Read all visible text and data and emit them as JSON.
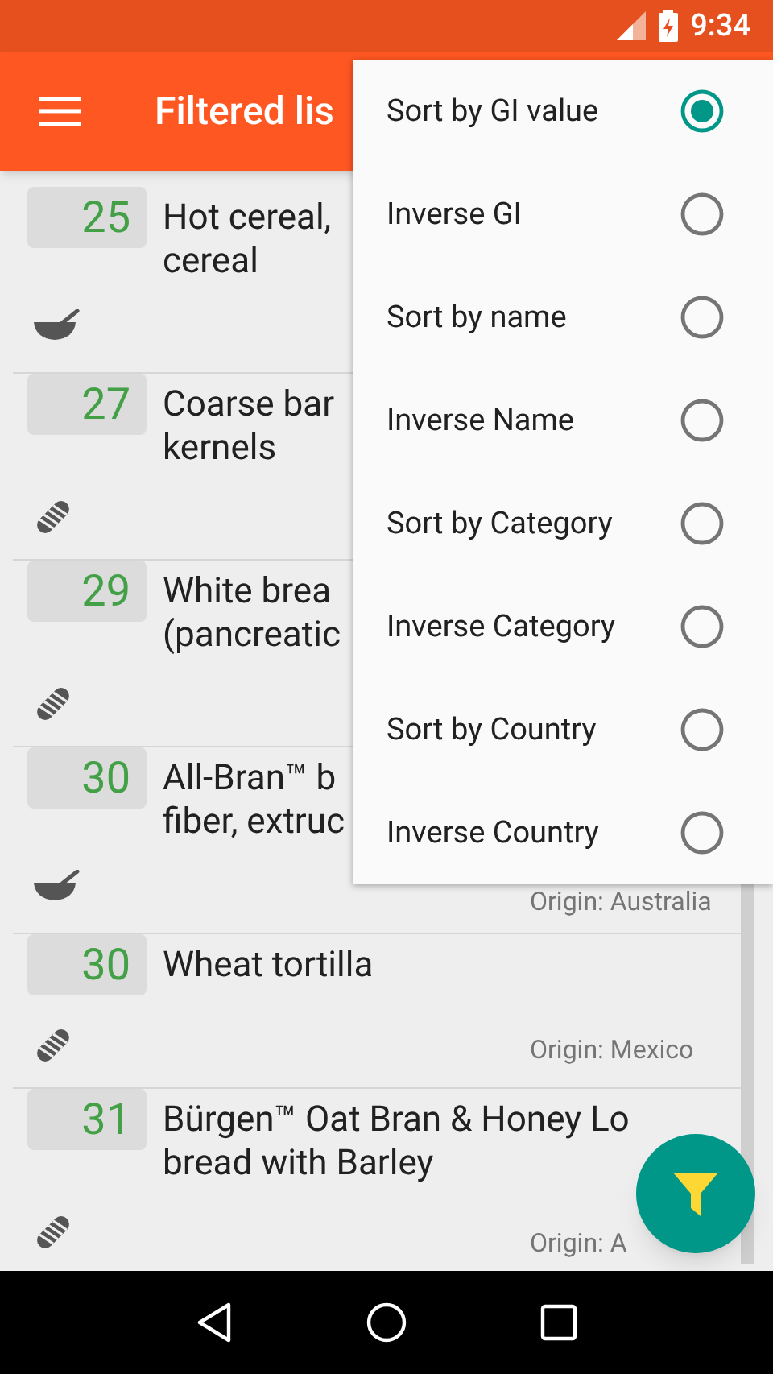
{
  "status_bar": {
    "time": "9:34"
  },
  "app_bar": {
    "title": "Filtered lis"
  },
  "rows": [
    {
      "gi": "25",
      "title_lines": [
        "Hot cereal,",
        "cereal"
      ],
      "kind": "bowl"
    },
    {
      "gi": "27",
      "title_lines": [
        "Coarse bar",
        "kernels"
      ],
      "kind": "bread"
    },
    {
      "gi": "29",
      "title_lines": [
        "White brea",
        "(pancreatic"
      ],
      "kind": "bread"
    },
    {
      "gi": "30",
      "title_lines": [
        "All-Bran™ b",
        "fiber, extruc"
      ],
      "kind": "bowl",
      "origin": "Origin: Australia"
    },
    {
      "gi": "30",
      "title_lines": [
        "Wheat tortilla"
      ],
      "kind": "bread",
      "origin": "Origin: Mexico"
    },
    {
      "gi": "31",
      "title_lines": [
        "Bürgen™ Oat Bran & Honey Lo",
        "bread with Barley"
      ],
      "kind": "bread",
      "origin": "Origin: A"
    }
  ],
  "sort_menu": [
    {
      "label": "Sort by GI value",
      "selected": true
    },
    {
      "label": "Inverse GI",
      "selected": false
    },
    {
      "label": "Sort by name",
      "selected": false
    },
    {
      "label": "Inverse Name",
      "selected": false
    },
    {
      "label": "Sort by Category",
      "selected": false
    },
    {
      "label": "Inverse Category",
      "selected": false
    },
    {
      "label": "Sort by Country",
      "selected": false
    },
    {
      "label": "Inverse Country",
      "selected": false
    }
  ]
}
